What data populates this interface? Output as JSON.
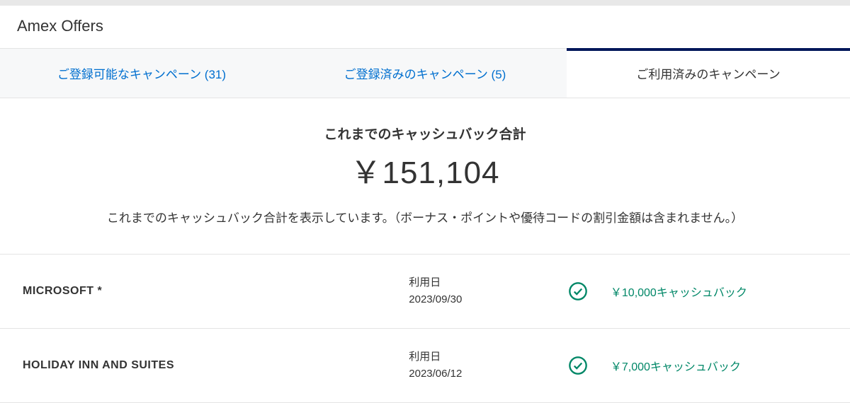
{
  "header": {
    "title": "Amex Offers"
  },
  "tabs": {
    "available": "ご登録可能なキャンペーン (31)",
    "registered": "ご登録済みのキャンペーン (5)",
    "used": "ご利用済みのキャンペーン"
  },
  "summary": {
    "label": "これまでのキャッシュバック合計",
    "amount": "￥151,104",
    "note": "これまでのキャッシュバック合計を表示しています。（ボーナス・ポイントや優待コードの割引金額は含まれません。）"
  },
  "rows": [
    {
      "merchant": "MICROSOFT *",
      "use_label": "利用日",
      "use_date": "2023/09/30",
      "reward": "￥10,000キャッシュバック"
    },
    {
      "merchant": "HOLIDAY INN AND SUITES",
      "use_label": "利用日",
      "use_date": "2023/06/12",
      "reward": "￥7,000キャッシュバック"
    }
  ]
}
